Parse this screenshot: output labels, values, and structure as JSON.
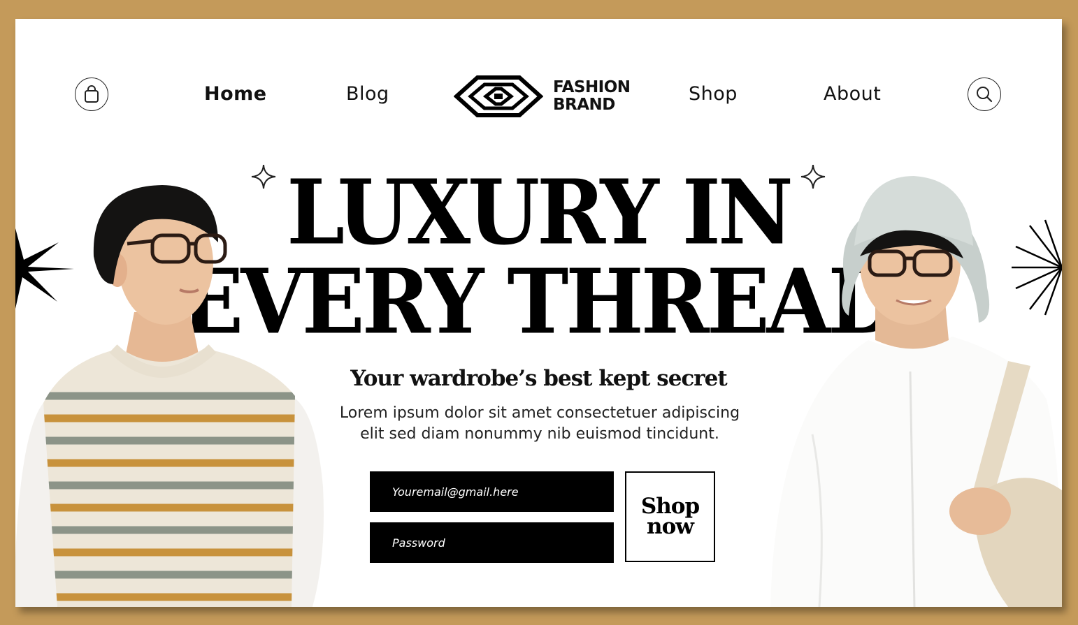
{
  "nav": {
    "links": [
      "Home",
      "Blog",
      "Shop",
      "About"
    ],
    "active": "Home",
    "bag_icon": "shopping-bag-icon",
    "search_icon": "search-icon"
  },
  "brand": {
    "line1": "FASHION",
    "line2": "BRAND",
    "logo_icon": "diamond-logo-icon"
  },
  "hero": {
    "headline_line1": "LUXURY IN",
    "headline_line2": "EVERY THREAD",
    "subheading": "Your wardrobe’s best kept secret",
    "description_line1": "Lorem ipsum dolor sit amet consectetuer adipiscing",
    "description_line2": "elit sed diam nonummy nib euismod tincidunt."
  },
  "form": {
    "email_placeholder": "Youremail@gmail.here",
    "password_placeholder": "Password",
    "button_line1": "Shop",
    "button_line2": "now"
  },
  "colors": {
    "background": "#c49a5a",
    "panel": "#ffffff",
    "ink": "#000000",
    "stripe_orange": "#c8923c",
    "stripe_gray": "#8c9488"
  }
}
